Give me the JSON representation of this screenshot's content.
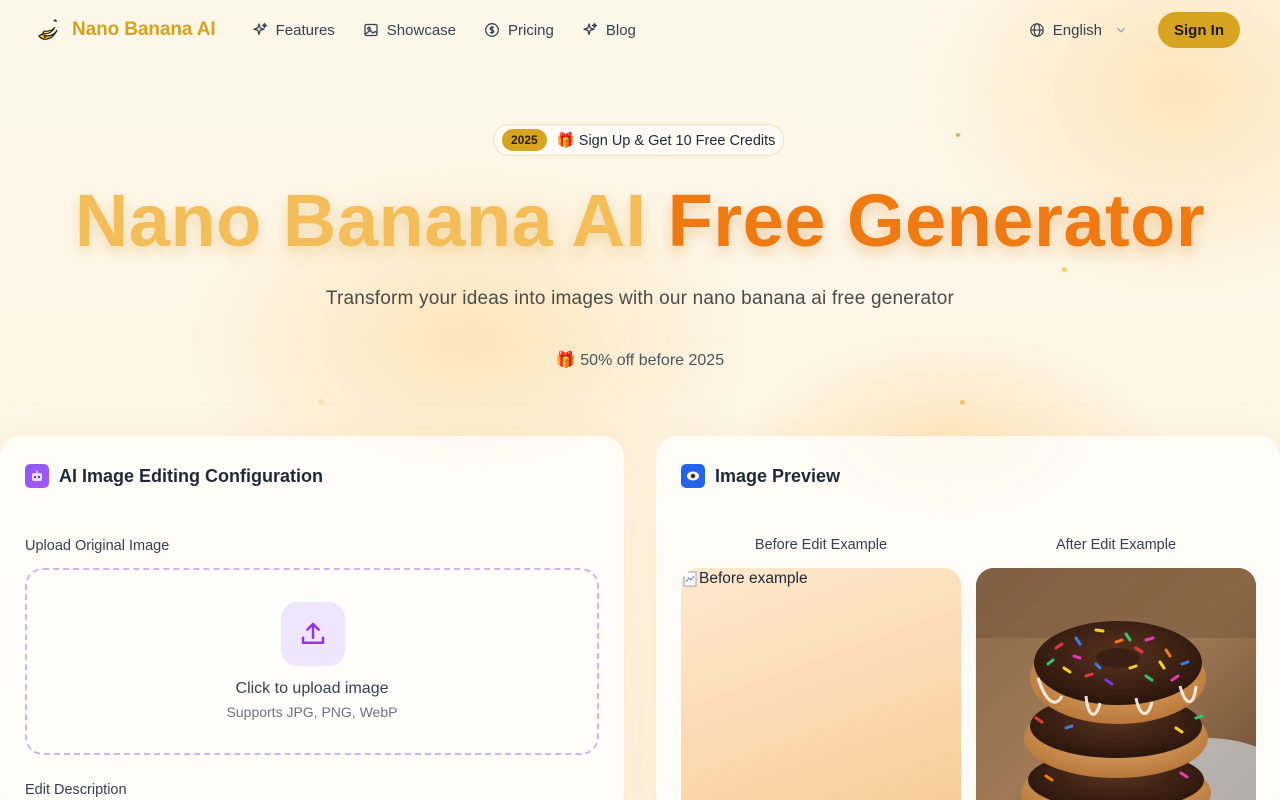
{
  "brand": {
    "name": "Nano Banana AI",
    "logo_icon": "banana-icon"
  },
  "nav": {
    "links": [
      {
        "label": "Features",
        "icon": "sparkles-icon"
      },
      {
        "label": "Showcase",
        "icon": "image-icon"
      },
      {
        "label": "Pricing",
        "icon": "dollar-circle-icon"
      },
      {
        "label": "Blog",
        "icon": "sparkles-icon"
      }
    ],
    "language": "English",
    "signin_label": "Sign In"
  },
  "hero": {
    "promo_year": "2025",
    "promo_text": "🎁 Sign Up & Get 10 Free Credits",
    "title_part1": "Nano Banana AI",
    "title_part2": "Free Generator",
    "subtitle": "Transform your ideas into images with our nano banana ai free generator",
    "offer": "🎁 50% off before 2025"
  },
  "config_card": {
    "title": "AI Image Editing Configuration",
    "upload_label": "Upload Original Image",
    "upload_title": "Click to upload image",
    "upload_sub": "Supports JPG, PNG, WebP",
    "edit_label": "Edit Description"
  },
  "preview_card": {
    "title": "Image Preview",
    "before_label": "Before Edit Example",
    "after_label": "After Edit Example",
    "before_alt": "Before example"
  },
  "colors": {
    "brand": "#d6a21f",
    "accent_orange": "#ef7a12",
    "upload_border": "#cdb5f0"
  }
}
